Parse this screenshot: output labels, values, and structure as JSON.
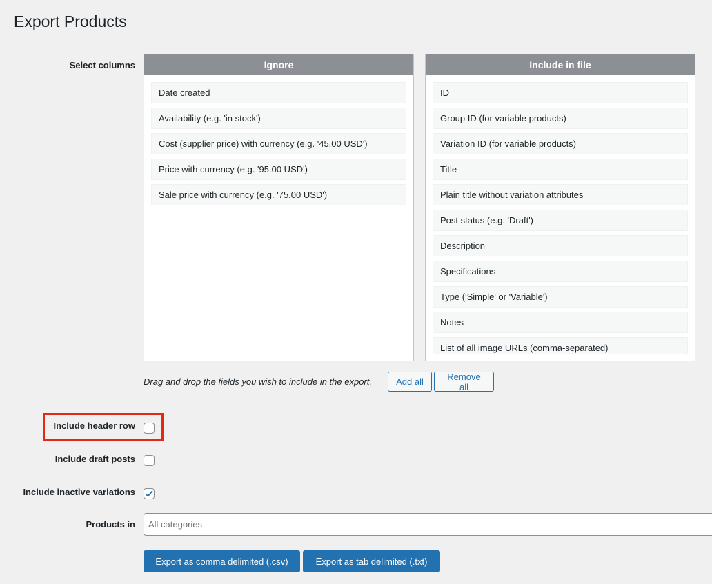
{
  "page": {
    "title": "Export Products"
  },
  "columns": {
    "label": "Select columns",
    "ignore": {
      "header": "Ignore",
      "items": [
        "Date created",
        "Availability (e.g. 'in stock')",
        "Cost (supplier price) with currency (e.g. '45.00 USD')",
        "Price with currency (e.g. '95.00 USD')",
        "Sale price with currency (e.g. '75.00 USD')"
      ]
    },
    "include": {
      "header": "Include in file",
      "items": [
        "ID",
        "Group ID (for variable products)",
        "Variation ID (for variable products)",
        "Title",
        "Plain title without variation attributes",
        "Post status (e.g. 'Draft')",
        "Description",
        "Specifications",
        "Type ('Simple' or 'Variable')",
        "Notes",
        "List of all image URLs (comma-separated)"
      ]
    },
    "hint": "Drag and drop the fields you wish to include in the export.",
    "add_all": "Add all",
    "remove_all": "Remove all"
  },
  "options": {
    "header_row": {
      "label": "Include header row",
      "checked": false
    },
    "draft_posts": {
      "label": "Include draft posts",
      "checked": false
    },
    "inactive_variations": {
      "label": "Include inactive variations",
      "checked": true
    }
  },
  "products_in": {
    "label": "Products in",
    "placeholder": "All categories"
  },
  "actions": {
    "export_csv": "Export as comma delimited (.csv)",
    "export_tab": "Export as tab delimited (.txt)"
  },
  "colors": {
    "accent": "#2271b1",
    "highlight": "#e32914",
    "box_header": "#8c8f94"
  }
}
